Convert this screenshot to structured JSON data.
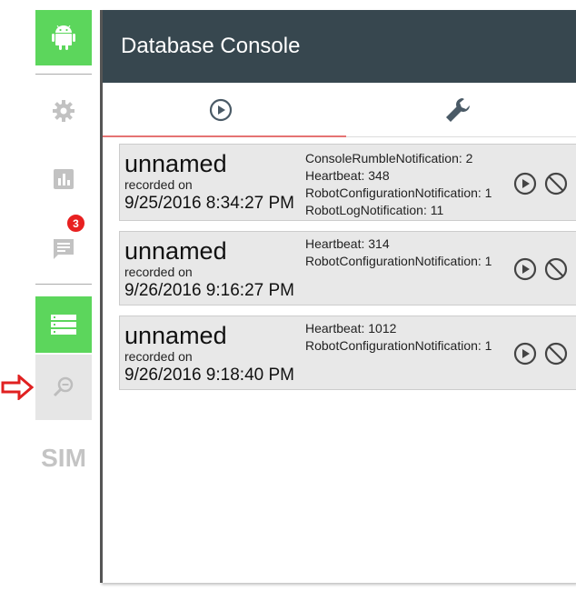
{
  "panel": {
    "title": "Database Console"
  },
  "rail": {
    "messages_badge": "3",
    "sim_label": "SIM"
  },
  "tabs": [
    {
      "icon": "play-circle-icon",
      "active": true
    },
    {
      "icon": "wrench-icon",
      "active": false
    }
  ],
  "recordings": [
    {
      "name": "unnamed",
      "recorded_label": "recorded on",
      "date": "9/25/2016 8:34:27 PM",
      "stats": [
        "ConsoleRumbleNotification: 2",
        "Heartbeat: 348",
        "RobotConfigurationNotification: 1",
        "RobotLogNotification: 11"
      ]
    },
    {
      "name": "unnamed",
      "recorded_label": "recorded on",
      "date": "9/26/2016 9:16:27 PM",
      "stats": [
        "Heartbeat: 314",
        "RobotConfigurationNotification: 1"
      ]
    },
    {
      "name": "unnamed",
      "recorded_label": "recorded on",
      "date": "9/26/2016 9:18:40 PM",
      "stats": [
        "Heartbeat: 1012",
        "RobotConfigurationNotification: 1"
      ]
    }
  ],
  "colors": {
    "accent_green": "#5cd65c",
    "header_bg": "#37474f",
    "tab_underline": "#e57373",
    "badge_red": "#e82020",
    "arrow_red": "#e02020"
  }
}
